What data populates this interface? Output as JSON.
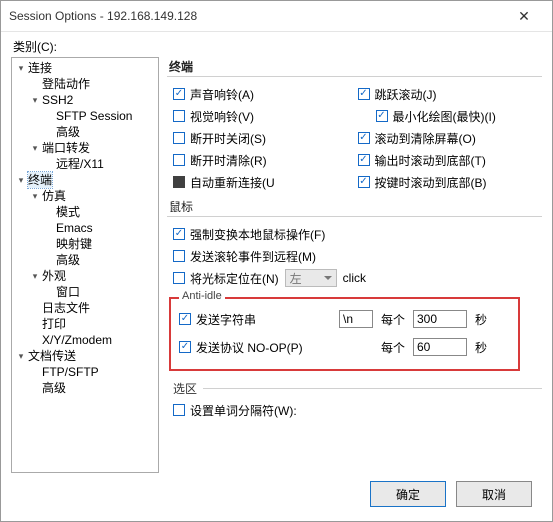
{
  "title": "Session Options - 192.168.149.128",
  "category_label": "类别(C):",
  "tree": {
    "conn": "连接",
    "login": "登陆动作",
    "ssh2": "SSH2",
    "sftp": "SFTP Session",
    "advanced1": "高级",
    "portfwd": "端口转发",
    "remote": "远程/X11",
    "terminal": "终端",
    "emulation": "仿真",
    "mode": "模式",
    "emacs": "Emacs",
    "mapkeys": "映射键",
    "advanced2": "高级",
    "appearance": "外观",
    "window": "窗口",
    "logfile": "日志文件",
    "print": "打印",
    "xyz": "X/Y/Zmodem",
    "filetrans": "文档传送",
    "ftpsftp": "FTP/SFTP",
    "advanced3": "高级"
  },
  "panel": {
    "terminal_header": "终端",
    "opts": {
      "beep_audio": "声音响铃(A)",
      "beep_visual": "视觉响铃(V)",
      "close_on_disc": "断开时关闭(S)",
      "clear_on_disc": "断开时清除(R)",
      "auto_reconnect": "自动重新连接(U",
      "jump_scroll": "跳跃滚动(J)",
      "min_redraw": "最小化绘图(最快)(I)",
      "scroll_to_clear": "滚动到清除屏幕(O)",
      "scroll_bottom_out": "输出时滚动到底部(T)",
      "scroll_bottom_key": "按键时滚动到底部(B)"
    },
    "mouse_header": "鼠标",
    "mouse": {
      "force_local": "强制变换本地鼠标操作(F)",
      "send_wheel": "发送滚轮事件到远程(M)",
      "position_cursor": "将光标定位在(N)",
      "select_value": "左",
      "click": "click"
    },
    "anti_idle": {
      "legend": "Anti-idle",
      "send_string": "发送字符串",
      "string_value": "\\n",
      "every": "每个",
      "seconds": "秒",
      "interval1": "300",
      "send_noop": "发送协议 NO-OP(P)",
      "interval2": "60"
    },
    "selection_header": "选区",
    "word_delim": "设置单词分隔符(W):"
  },
  "buttons": {
    "ok": "确定",
    "cancel": "取消"
  }
}
